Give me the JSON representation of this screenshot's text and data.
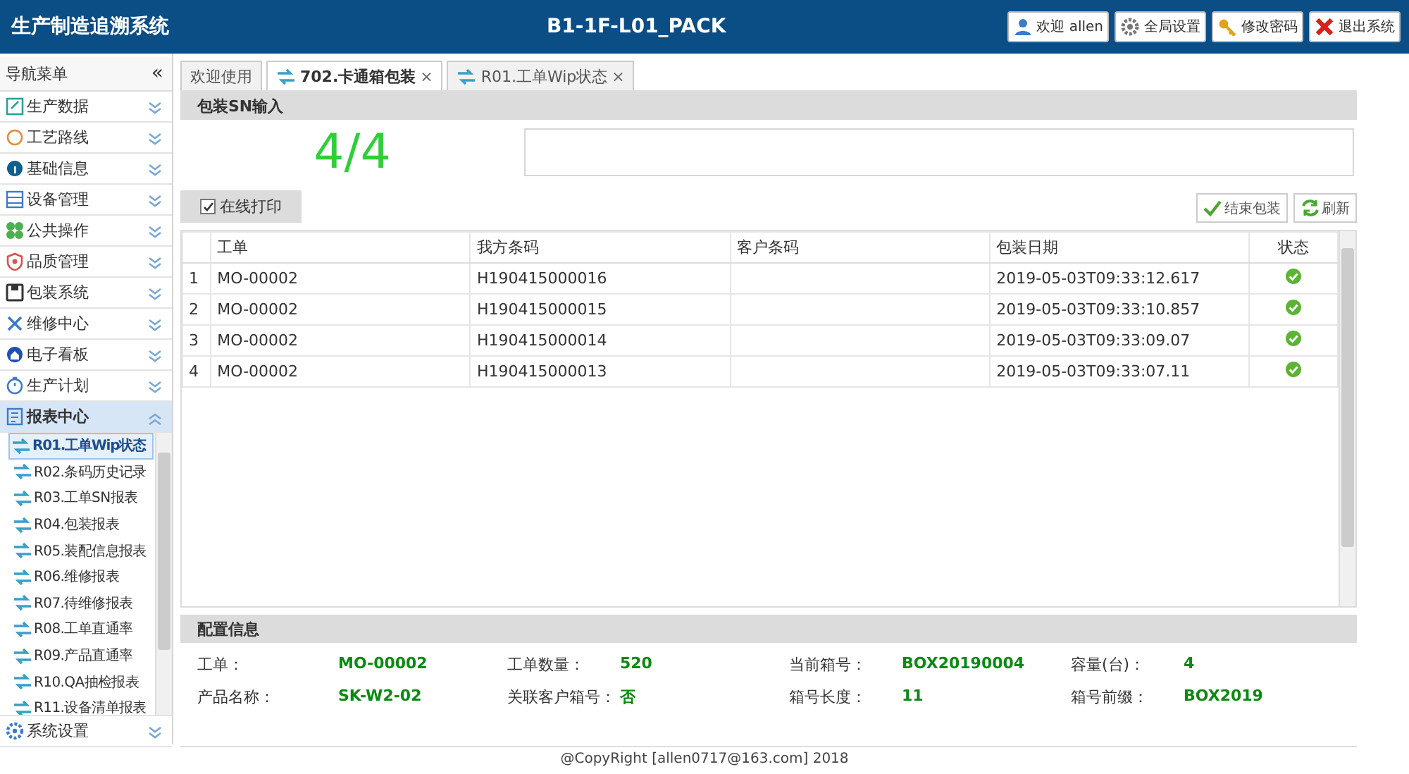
{
  "header": {
    "app_title": "生产制造追溯系统",
    "station": "B1-1F-L01_PACK",
    "buttons": [
      {
        "kind": "user",
        "label": "欢迎 allen"
      },
      {
        "kind": "settings",
        "label": "全局设置"
      },
      {
        "kind": "key",
        "label": "修改密码"
      },
      {
        "kind": "exit",
        "label": "退出系统"
      }
    ]
  },
  "sidebar": {
    "title": "导航菜单",
    "collapse": "«",
    "items": [
      {
        "label": "生产数据",
        "expanded": false
      },
      {
        "label": "工艺路线",
        "expanded": false
      },
      {
        "label": "基础信息",
        "expanded": false
      },
      {
        "label": "设备管理",
        "expanded": false
      },
      {
        "label": "公共操作",
        "expanded": false
      },
      {
        "label": "品质管理",
        "expanded": false
      },
      {
        "label": "包装系统",
        "expanded": false
      },
      {
        "label": "维修中心",
        "expanded": false
      },
      {
        "label": "电子看板",
        "expanded": false
      },
      {
        "label": "生产计划",
        "expanded": false
      },
      {
        "label": "报表中心",
        "expanded": true,
        "children": [
          {
            "label": "R01.工单Wip状态",
            "selected": true
          },
          {
            "label": "R02.条码历史记录",
            "selected": false
          },
          {
            "label": "R03.工单SN报表",
            "selected": false
          },
          {
            "label": "R04.包装报表",
            "selected": false
          },
          {
            "label": "R05.装配信息报表",
            "selected": false
          },
          {
            "label": "R06.维修报表",
            "selected": false
          },
          {
            "label": "R07.待维修报表",
            "selected": false
          },
          {
            "label": "R08.工单直通率",
            "selected": false
          },
          {
            "label": "R09.产品直通率",
            "selected": false
          },
          {
            "label": "R10.QA抽检报表",
            "selected": false
          },
          {
            "label": "R11.设备清单报表",
            "selected": false
          }
        ]
      },
      {
        "label": "系统设置",
        "expanded": false
      }
    ]
  },
  "tabs": [
    {
      "label": "欢迎使用",
      "selected": false
    },
    {
      "label": "702.卡通箱包装",
      "selected": true,
      "close": "×"
    },
    {
      "label": "R01.工单Wip状态",
      "selected": false,
      "close": "×"
    }
  ],
  "sn_panel": {
    "title": "包装SN输入",
    "count": "4/4"
  },
  "toolbar": {
    "online_print": {
      "label": "在线打印",
      "checked": true
    },
    "buttons": [
      {
        "kind": "finish",
        "label": "结束包装"
      },
      {
        "kind": "refresh",
        "label": "刷新"
      }
    ]
  },
  "table": {
    "columns": [
      "工单",
      "我方条码",
      "客户条码",
      "包装日期",
      "状态"
    ],
    "rows": [
      {
        "index": "1",
        "order": "MO-00002",
        "own_code": "H190415000016",
        "date": "2019-05-03T09:33:12.617",
        "done": true
      },
      {
        "index": "2",
        "order": "MO-00002",
        "own_code": "H190415000015",
        "date": "2019-05-03T09:33:10.857",
        "done": true
      },
      {
        "index": "3",
        "order": "MO-00002",
        "own_code": "H190415000014",
        "date": "2019-05-03T09:33:09.07",
        "done": true
      },
      {
        "index": "4",
        "order": "MO-00002",
        "own_code": "H190415000013",
        "date": "2019-05-03T09:33:07.11",
        "done": true
      }
    ]
  },
  "config": {
    "title": "配置信息",
    "fields": [
      {
        "label": "工单：",
        "value": "MO-00002"
      },
      {
        "label": "工单数量：",
        "value": "520"
      },
      {
        "label": "当前箱号：",
        "value": "BOX20190004"
      },
      {
        "label": "容量(台)：",
        "value": "4"
      },
      {
        "label": "产品名称：",
        "value": "SK-W2-02"
      },
      {
        "label": "关联客户箱号：",
        "value": "否"
      },
      {
        "label": "箱号长度：",
        "value": "11"
      },
      {
        "label": "箱号前缀：",
        "value": "BOX2019"
      }
    ]
  },
  "footer": "@CopyRight [allen0717@163.com] 2018"
}
